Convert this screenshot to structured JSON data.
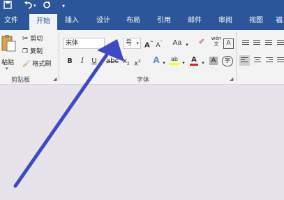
{
  "quick_access": {
    "save_icon": "save-icon",
    "undo_icon": "undo-icon",
    "redo_icon": "redo-icon",
    "customize_icon": "customize-icon"
  },
  "tabs": [
    {
      "label": "文件"
    },
    {
      "label": "开始"
    },
    {
      "label": "插入"
    },
    {
      "label": "设计"
    },
    {
      "label": "布局"
    },
    {
      "label": "引用"
    },
    {
      "label": "邮件"
    },
    {
      "label": "审阅"
    },
    {
      "label": "视图"
    },
    {
      "label": "福"
    }
  ],
  "clipboard": {
    "paste_label": "粘贴",
    "cut_label": "剪切",
    "copy_label": "复制",
    "format_painter_label": "格式刷",
    "group_label": "剪贴板"
  },
  "font": {
    "font_name": "宋体",
    "size_char": "号",
    "group_label": "字体",
    "aa_label": "Aa",
    "wen_label": "wén",
    "a_label": "A"
  },
  "colors": {
    "accent": "#2b579a",
    "highlight": "#ffff00",
    "font_color": "#e02020",
    "arrow": "#3d4ac4"
  }
}
